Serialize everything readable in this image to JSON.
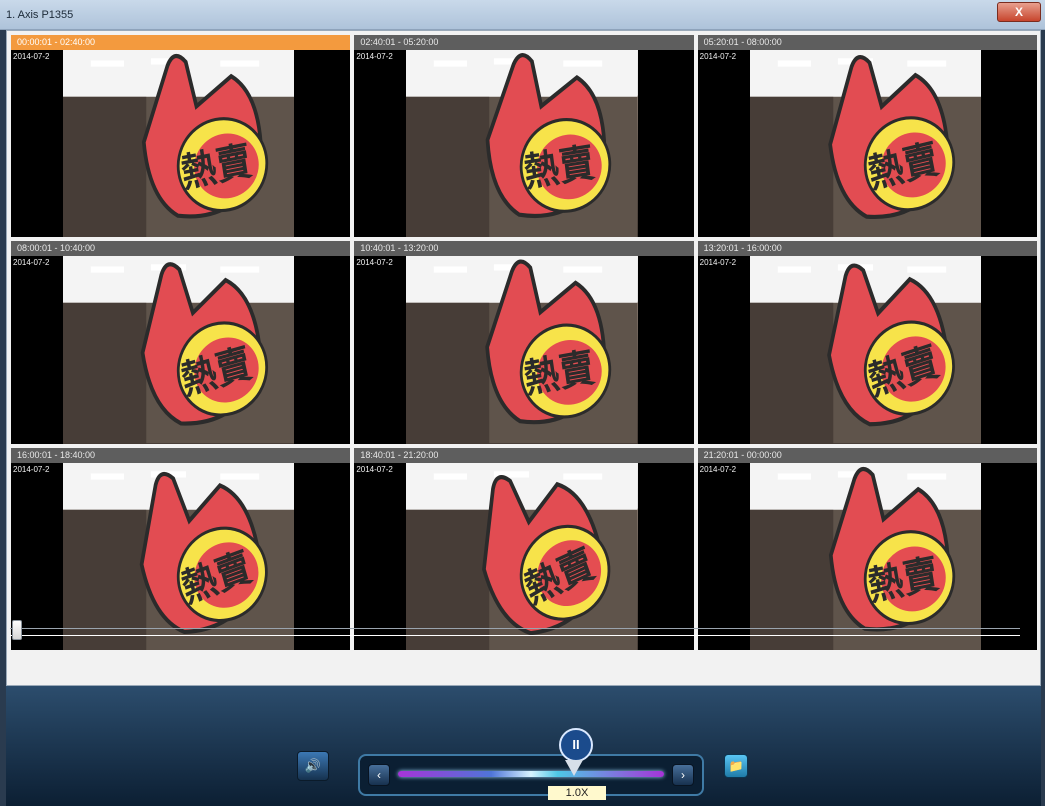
{
  "window": {
    "title": "1. Axis P1355",
    "close_label": "X"
  },
  "tiles": [
    {
      "range": "00:00:01 - 02:40:00",
      "date": "2014-07-2"
    },
    {
      "range": "02:40:01 - 05:20:00",
      "date": "2014-07-2"
    },
    {
      "range": "05:20:01 - 08:00:00",
      "date": "2014-07-2"
    },
    {
      "range": "08:00:01 - 10:40:00",
      "date": "2014-07-2"
    },
    {
      "range": "10:40:01 - 13:20:00",
      "date": "2014-07-2"
    },
    {
      "range": "13:20:01 - 16:00:00",
      "date": "2014-07-2"
    },
    {
      "range": "16:00:01 - 18:40:00",
      "date": "2014-07-2"
    },
    {
      "range": "18:40:01 - 21:20:00",
      "date": "2014-07-2"
    },
    {
      "range": "21:20:01 - 00:00:00",
      "date": "2014-07-2"
    }
  ],
  "selected_tile": 0,
  "controls": {
    "speed_label": "1.0X",
    "sign_text": "熱賣"
  }
}
